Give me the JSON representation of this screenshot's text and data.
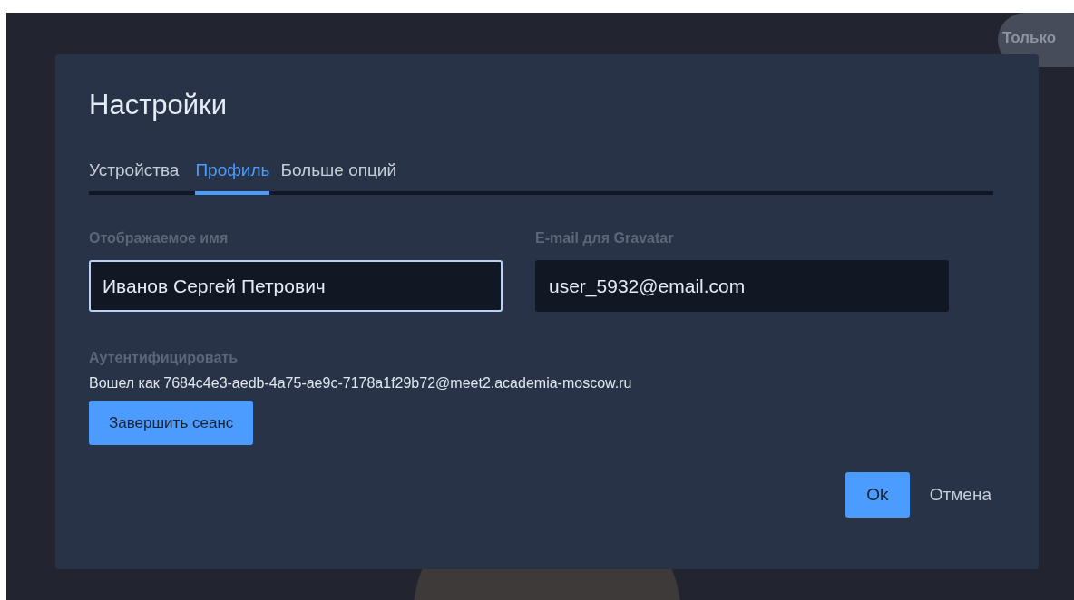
{
  "background": {
    "badge": "Только"
  },
  "dialog": {
    "title": "Настройки",
    "tabs": [
      {
        "label": "Устройства",
        "selected": false
      },
      {
        "label": "Профиль",
        "selected": true
      },
      {
        "label": "Больше опций",
        "selected": false
      }
    ],
    "fields": [
      {
        "label": "Отображаемое имя",
        "value": "Иванов Сергей Петрович",
        "focused": true
      },
      {
        "label": "E-mail для Gravatar",
        "value": "user_5932@email.com",
        "focused": false
      }
    ],
    "auth": {
      "heading": "Аутентифицировать",
      "status": "Вошел как 7684c4e3-aedb-4a75-ae9c-7178a1f29b72@meet2.academia-moscow.ru",
      "button": "Завершить сеанс"
    },
    "buttons": [
      {
        "label": "Ok",
        "kind": "primary"
      },
      {
        "label": "Отмена",
        "kind": "link"
      }
    ]
  }
}
